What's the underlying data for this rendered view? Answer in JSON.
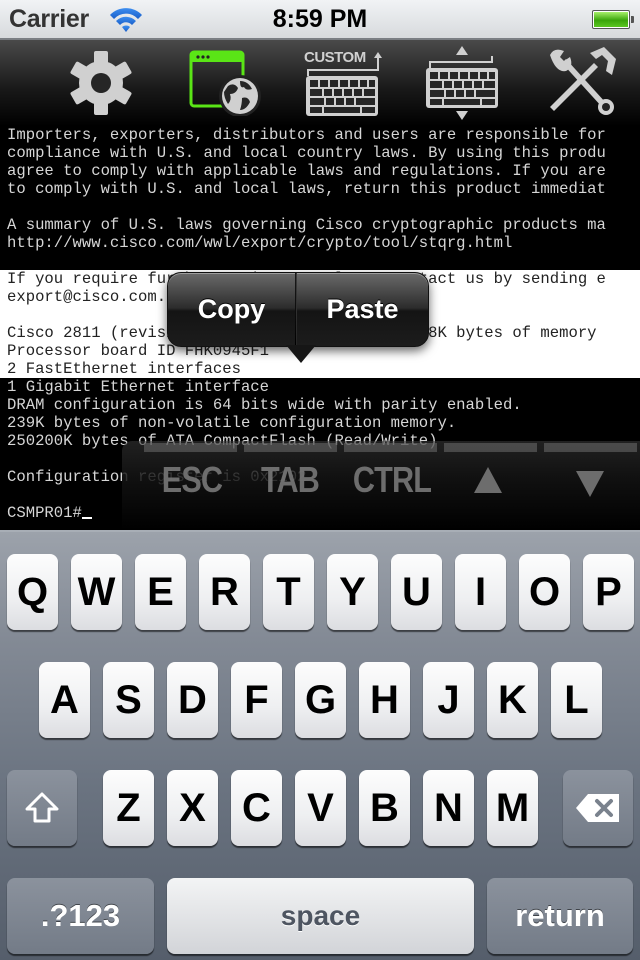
{
  "status_bar": {
    "carrier": "Carrier",
    "time": "8:59 PM",
    "battery_level": 1.0
  },
  "toolbar": {
    "items": [
      {
        "name": "settings",
        "icon": "gear-icon",
        "active": false
      },
      {
        "name": "web-browser",
        "icon": "browser-globe-icon",
        "active": true
      },
      {
        "name": "custom-keyboard",
        "icon": "custom-keyboard-icon",
        "label": "CUSTOM",
        "active": false
      },
      {
        "name": "keyboard-toggle",
        "icon": "keyboard-resize-icon",
        "active": false
      },
      {
        "name": "tools",
        "icon": "wrench-hammer-icon",
        "active": false
      }
    ],
    "active_color": "#5ae516",
    "icon_color": "#d0d0d0"
  },
  "terminal": {
    "lines": [
      "Importers, exporters, distributors and users are responsible for",
      "compliance with U.S. and local country laws. By using this produ",
      "agree to comply with applicable laws and regulations. If you are",
      "to comply with U.S. and local laws, return this product immediat",
      "",
      "A summary of U.S. laws governing Cisco cryptographic products ma",
      "http://www.cisco.com/wwl/export/crypto/tool/stqrg.html",
      "",
      "If you require further assistance please contact us by sending e",
      "export@cisco.com.",
      "",
      "Cisco 2811 (revision 53.51) with 249856K/12288K bytes of memory",
      "Processor board ID FHK0945F1",
      "2 FastEthernet interfaces",
      "1 Gigabit Ethernet interface",
      "DRAM configuration is 64 bits wide with parity enabled.",
      "239K bytes of non-volatile configuration memory.",
      "250200K bytes of ATA CompactFlash (Read/Write)",
      "",
      "Configuration register is 0x2102",
      "",
      "CSMPR01#"
    ],
    "selected_from_line": 8,
    "selected_to_line": 14,
    "prompt": "CSMPR01#"
  },
  "context_menu": {
    "copy": "Copy",
    "paste": "Paste"
  },
  "extra_keys": {
    "esc": "ESC",
    "tab": "TAB",
    "ctrl": "CTRL",
    "up": "▲",
    "down": "▼"
  },
  "keyboard": {
    "row1": [
      "Q",
      "W",
      "E",
      "R",
      "T",
      "Y",
      "U",
      "I",
      "O",
      "P"
    ],
    "row2": [
      "A",
      "S",
      "D",
      "F",
      "G",
      "H",
      "J",
      "K",
      "L"
    ],
    "row3": [
      "Z",
      "X",
      "C",
      "V",
      "B",
      "N",
      "M"
    ],
    "shift": "shift-icon",
    "delete": "delete-icon",
    "numbers": ".?123",
    "space": "space",
    "return": "return"
  }
}
